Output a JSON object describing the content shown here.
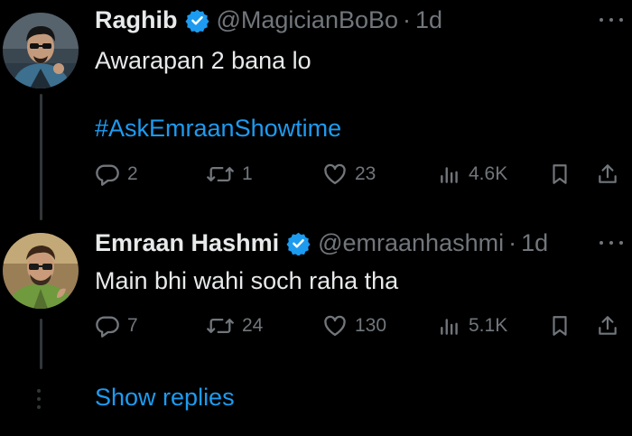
{
  "tweets": [
    {
      "name": "Raghib",
      "handle": "@MagicianBoBo",
      "separator": "·",
      "time": "1d",
      "text": "Awarapan 2 bana lo",
      "hashtag": "#AskEmraanShowtime",
      "replies": "2",
      "retweets": "1",
      "likes": "23",
      "views": "4.6K"
    },
    {
      "name": "Emraan Hashmi",
      "handle": "@emraanhashmi",
      "separator": "·",
      "time": "1d",
      "text": "Main bhi wahi soch raha tha",
      "replies": "7",
      "retweets": "24",
      "likes": "130",
      "views": "5.1K"
    }
  ],
  "show_replies_label": "Show replies",
  "colors": {
    "background": "#000000",
    "text": "#e7e9ea",
    "muted": "#71767b",
    "accent": "#1d9bf0",
    "thread_line": "#333639"
  },
  "icons": [
    "reply-icon",
    "retweet-icon",
    "like-icon",
    "views-icon",
    "bookmark-icon",
    "share-icon",
    "verified-badge-icon",
    "more-options-icon"
  ]
}
